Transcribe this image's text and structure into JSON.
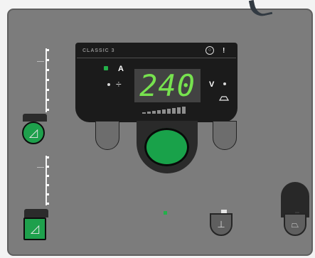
{
  "panel": {
    "model_label": "CLASSIC 3",
    "info_symbol": "!",
    "display_value": "240",
    "current_label": "A",
    "voltage_label": "V",
    "thickness_symbol": "÷",
    "bottom_left_icon": "◿",
    "bottom_left_icon_2": "◿",
    "bottom_mid_icon": "⊥",
    "bottom_right_icon": "⏢"
  }
}
